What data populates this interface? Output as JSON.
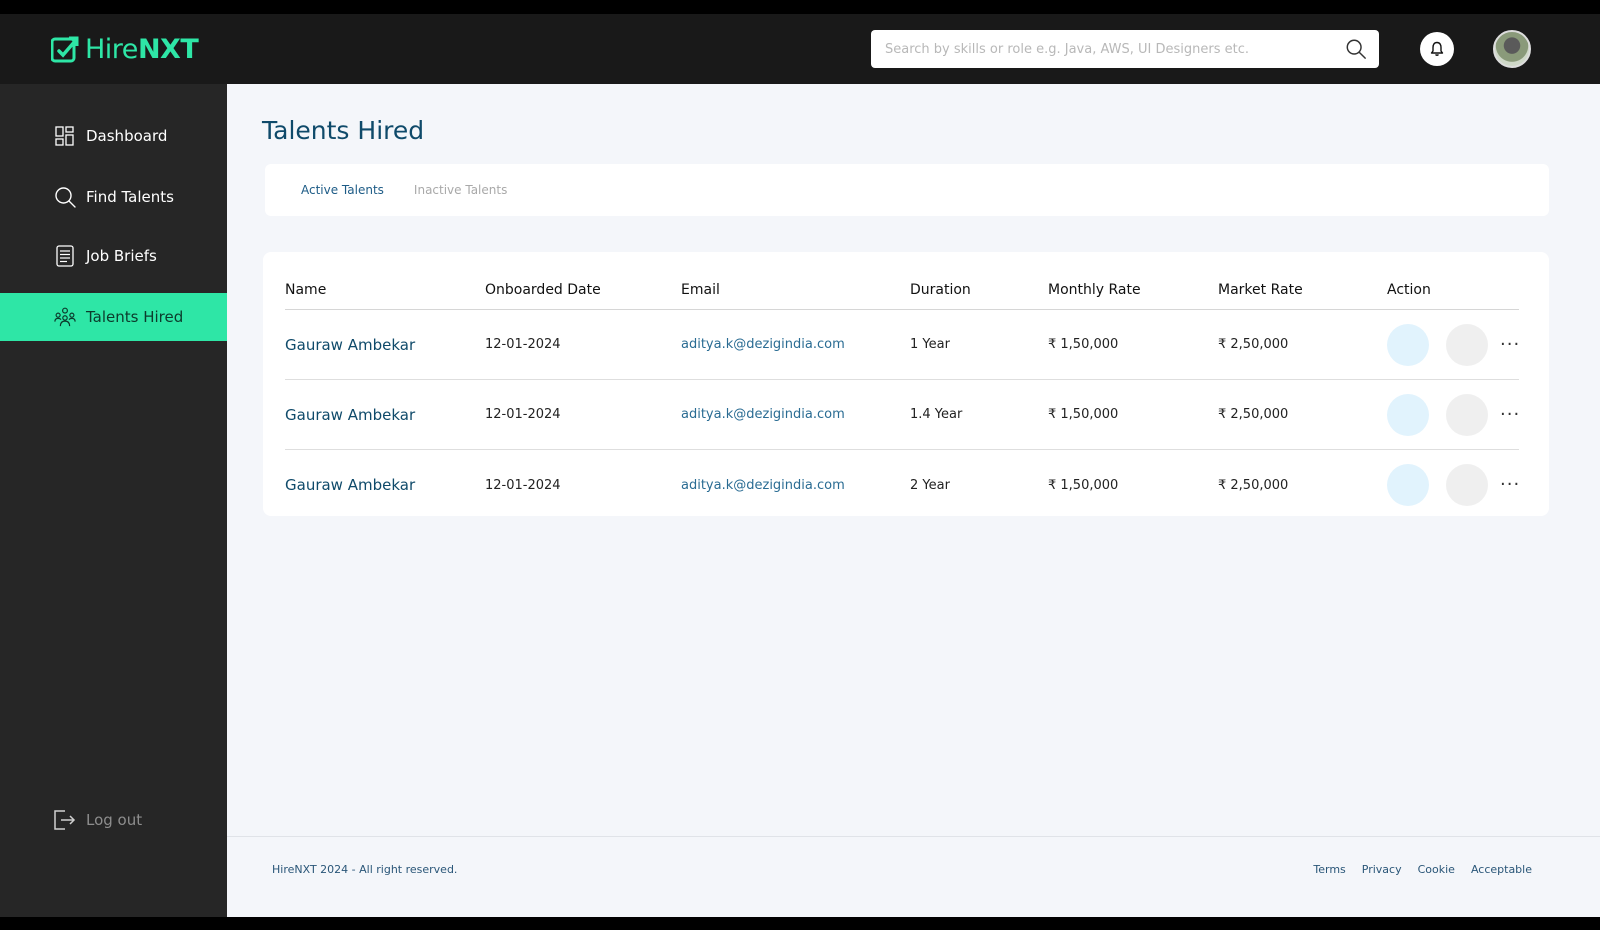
{
  "brand": {
    "name_light": "Hire",
    "name_bold": "NXT",
    "accent": "#2ee6a6"
  },
  "search": {
    "placeholder": "Search by skills or role e.g. Java, AWS, UI Designers etc.",
    "value": ""
  },
  "sidebar": {
    "items": [
      {
        "label": "Dashboard",
        "icon": "dashboard-icon"
      },
      {
        "label": "Find Talents",
        "icon": "search-icon"
      },
      {
        "label": "Job Briefs",
        "icon": "document-icon"
      },
      {
        "label": "Talents Hired",
        "icon": "team-icon",
        "active": true
      }
    ],
    "logout": "Log out"
  },
  "main": {
    "title": "Talents Hired",
    "tabs": [
      {
        "label": "Active Talents",
        "active": true
      },
      {
        "label": "Inactive Talents",
        "active": false
      }
    ],
    "table": {
      "headers": [
        "Name",
        "Onboarded Date",
        "Email",
        "Duration",
        "Monthly Rate",
        "Market Rate",
        "Action"
      ],
      "rows": [
        {
          "name": "Gauraw Ambekar",
          "date": "12-01-2024",
          "email": "aditya.k@dezigindia.com",
          "duration": "1 Year",
          "monthly": "₹ 1,50,000",
          "market": "₹ 2,50,000"
        },
        {
          "name": "Gauraw Ambekar",
          "date": "12-01-2024",
          "email": "aditya.k@dezigindia.com",
          "duration": "1.4 Year",
          "monthly": "₹ 1,50,000",
          "market": "₹ 2,50,000"
        },
        {
          "name": "Gauraw Ambekar",
          "date": "12-01-2024",
          "email": "aditya.k@dezigindia.com",
          "duration": "2 Year",
          "monthly": "₹ 1,50,000",
          "market": "₹ 2,50,000"
        }
      ],
      "more_label": "···"
    }
  },
  "footer": {
    "copyright": "HireNXT 2024 - All right reserved.",
    "links": [
      "Terms",
      "Privacy",
      "Cookie",
      "Acceptable"
    ]
  }
}
